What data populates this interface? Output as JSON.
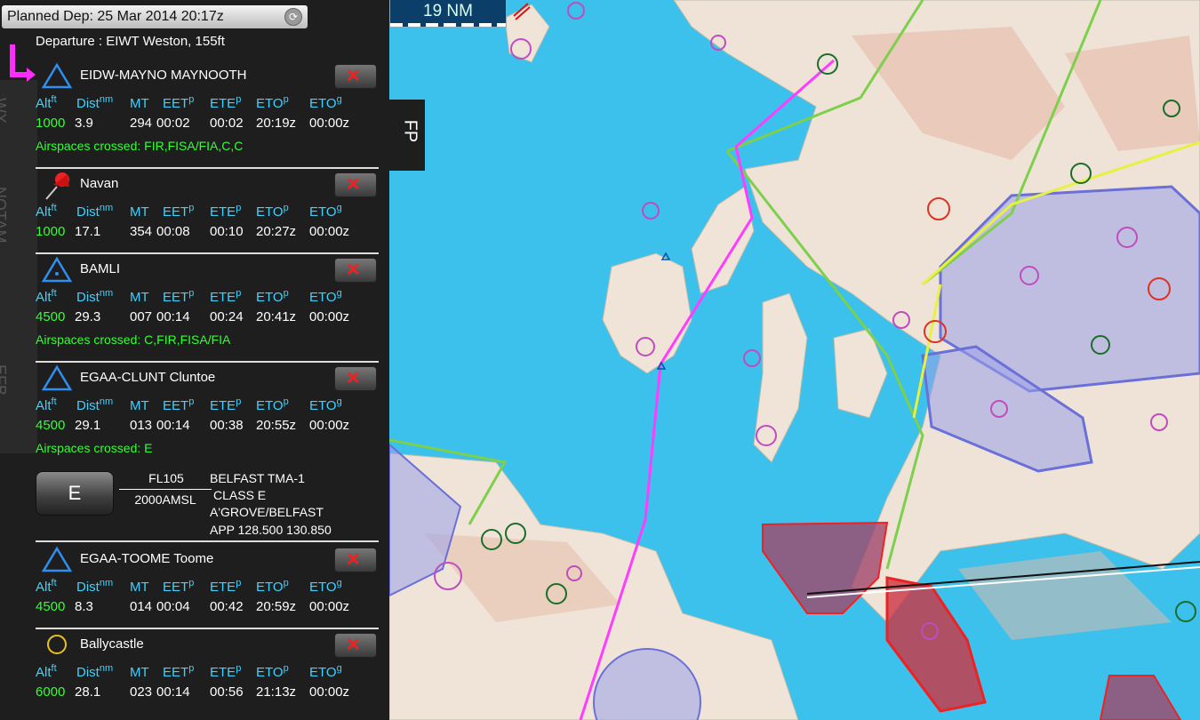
{
  "planned_dep": "Planned Dep: 25 Mar 2014 20:17z",
  "departure": "Departure : EIWT Weston, 155ft",
  "scale_label": "19 NM",
  "fp_tab": "FP",
  "side_tabs": [
    "EFB",
    "NOTAM",
    "WX"
  ],
  "columns": [
    "Alt",
    "Dist",
    "MT",
    "EET",
    "ETE",
    "ETO",
    "ETO"
  ],
  "column_units": [
    "ft",
    "nm",
    "",
    "p",
    "p",
    "p",
    "g"
  ],
  "waypoints": [
    {
      "icon": "triangle-icon",
      "name": "EIDW-MAYNO MAYNOOTH",
      "alt": "1000",
      "dist": "3.9",
      "mt": "294",
      "eet": "00:02",
      "ete": "00:02",
      "eto_p": "20:19z",
      "eto_g": "00:00z",
      "airspaces": "Airspaces crossed: FIR,FISA/FIA,C,C"
    },
    {
      "icon": "pushpin-icon",
      "name": "Navan",
      "alt": "1000",
      "dist": "17.1",
      "mt": "354",
      "eet": "00:08",
      "ete": "00:10",
      "eto_p": "20:27z",
      "eto_g": "00:00z",
      "airspaces": ""
    },
    {
      "icon": "triangle-dot-icon",
      "name": "BAMLI",
      "alt": "4500",
      "dist": "29.3",
      "mt": "007",
      "eet": "00:14",
      "ete": "00:24",
      "eto_p": "20:41z",
      "eto_g": "00:00z",
      "airspaces": "Airspaces crossed: C,FIR,FISA/FIA"
    },
    {
      "icon": "triangle-icon",
      "name": "EGAA-CLUNT Cluntoe",
      "alt": "4500",
      "dist": "29.1",
      "mt": "013",
      "eet": "00:14",
      "ete": "00:38",
      "eto_p": "20:55z",
      "eto_g": "00:00z",
      "airspaces": "Airspaces crossed: E"
    },
    {
      "icon": "triangle-icon",
      "name": "EGAA-TOOME Toome",
      "alt": "4500",
      "dist": "8.3",
      "mt": "014",
      "eet": "00:04",
      "ete": "00:42",
      "eto_p": "20:59z",
      "eto_g": "00:00z",
      "airspaces": ""
    },
    {
      "icon": "circle-icon",
      "name": "Ballycastle",
      "alt": "6000",
      "dist": "28.1",
      "mt": "023",
      "eet": "00:14",
      "ete": "00:56",
      "eto_p": "21:13z",
      "eto_g": "00:00z",
      "airspaces": ""
    }
  ],
  "airspace_info": {
    "class": "E",
    "upper": "FL105",
    "lower": "2000AMSL",
    "lines": [
      "BELFAST TMA-1",
      "CLASS E",
      "A'GROVE/BELFAST",
      "APP 128.500 130.850"
    ]
  },
  "colors": {
    "accent_cyan": "#3fd2ff",
    "alt_green": "#33ff33",
    "route_magenta": "#ff3cff",
    "sea": "#3cc0ec"
  }
}
